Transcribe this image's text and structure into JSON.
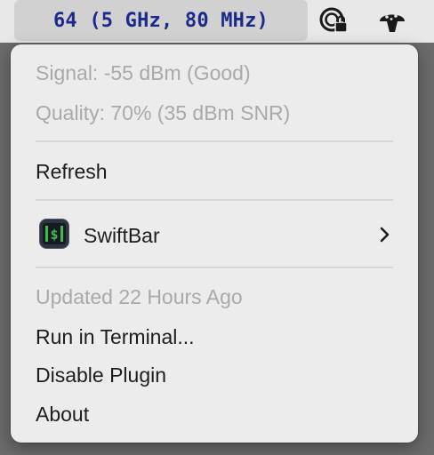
{
  "menubar": {
    "status_text": "64 (5 GHz, 80 MHz)",
    "icons": [
      "privacy-lock-icon",
      "mushroom-icon"
    ]
  },
  "menu": {
    "signal": "Signal: -55 dBm (Good)",
    "quality": "Quality: 70% (35 dBm SNR)",
    "refresh": "Refresh",
    "app_name": "SwiftBar",
    "updated": "Updated 22 Hours Ago",
    "run_in_terminal": "Run in Terminal...",
    "disable_plugin": "Disable Plugin",
    "about": "About"
  },
  "colors": {
    "status_text": "#1c2a8a",
    "disabled_text": "#a9a9a9",
    "menu_background": "#ececec"
  }
}
